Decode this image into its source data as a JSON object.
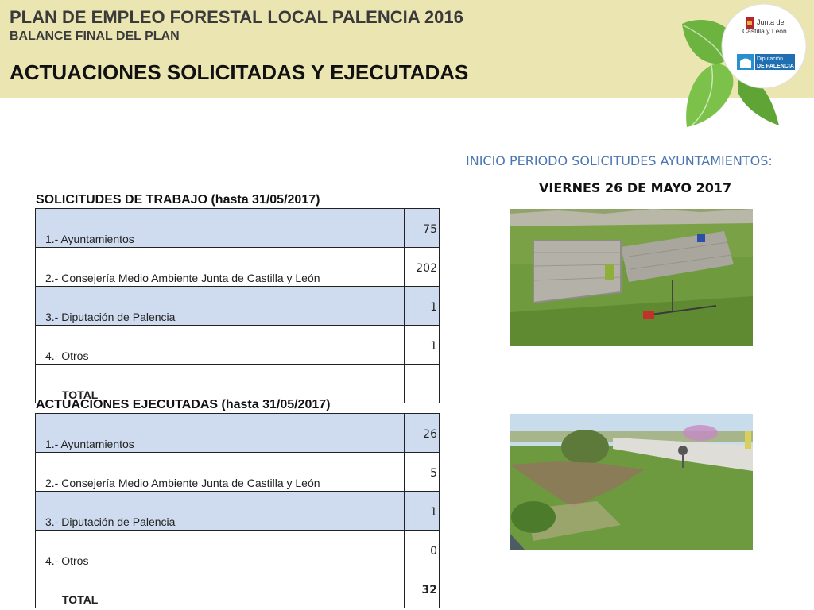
{
  "header": {
    "title": "PLAN DE EMPLEO FORESTAL LOCAL PALENCIA 2016",
    "subtitle": "BALANCE FINAL DEL PLAN",
    "heading": "ACTUACIONES SOLICITADAS Y EJECUTADAS"
  },
  "logos": {
    "junta_line1": "Junta de",
    "junta_line2": "Castilla y León",
    "diputacion_line1": "Diputación",
    "diputacion_line2": "DE PALENCIA"
  },
  "info": {
    "inicio": "INICIO PERIODO SOLICITUDES AYUNTAMIENTOS:",
    "fecha": "VIERNES 26 DE MAYO 2017"
  },
  "solicitudes": {
    "caption": "SOLICITUDES DE TRABAJO (hasta 31/05/2017)",
    "rows": [
      {
        "label": "1.- Ayuntamientos",
        "value": "75"
      },
      {
        "label": "2.- Consejería Medio Ambiente Junta de Castilla y León",
        "value": "202"
      },
      {
        "label": "3.- Diputación de Palencia",
        "value": "1"
      },
      {
        "label": "4.- Otros",
        "value": "1"
      }
    ],
    "total_label": "TOTAL",
    "total_value": ""
  },
  "ejecutadas": {
    "caption": "ACTUACIONES EJECUTADAS (hasta 31/05/2017)",
    "rows": [
      {
        "label": "1.- Ayuntamientos",
        "value": "26"
      },
      {
        "label": "2.- Consejería Medio Ambiente Junta de Castilla y León",
        "value": "5"
      },
      {
        "label": "3.- Diputación de Palencia",
        "value": "1"
      },
      {
        "label": "4.- Otros",
        "value": "0"
      }
    ],
    "total_label": "TOTAL",
    "total_value": "32"
  },
  "colors": {
    "header_bg": "#ebe5b2",
    "row_shade": "#cfdcf0",
    "accent_blue": "#4b76b2",
    "leaf_green": "#6db33f"
  }
}
